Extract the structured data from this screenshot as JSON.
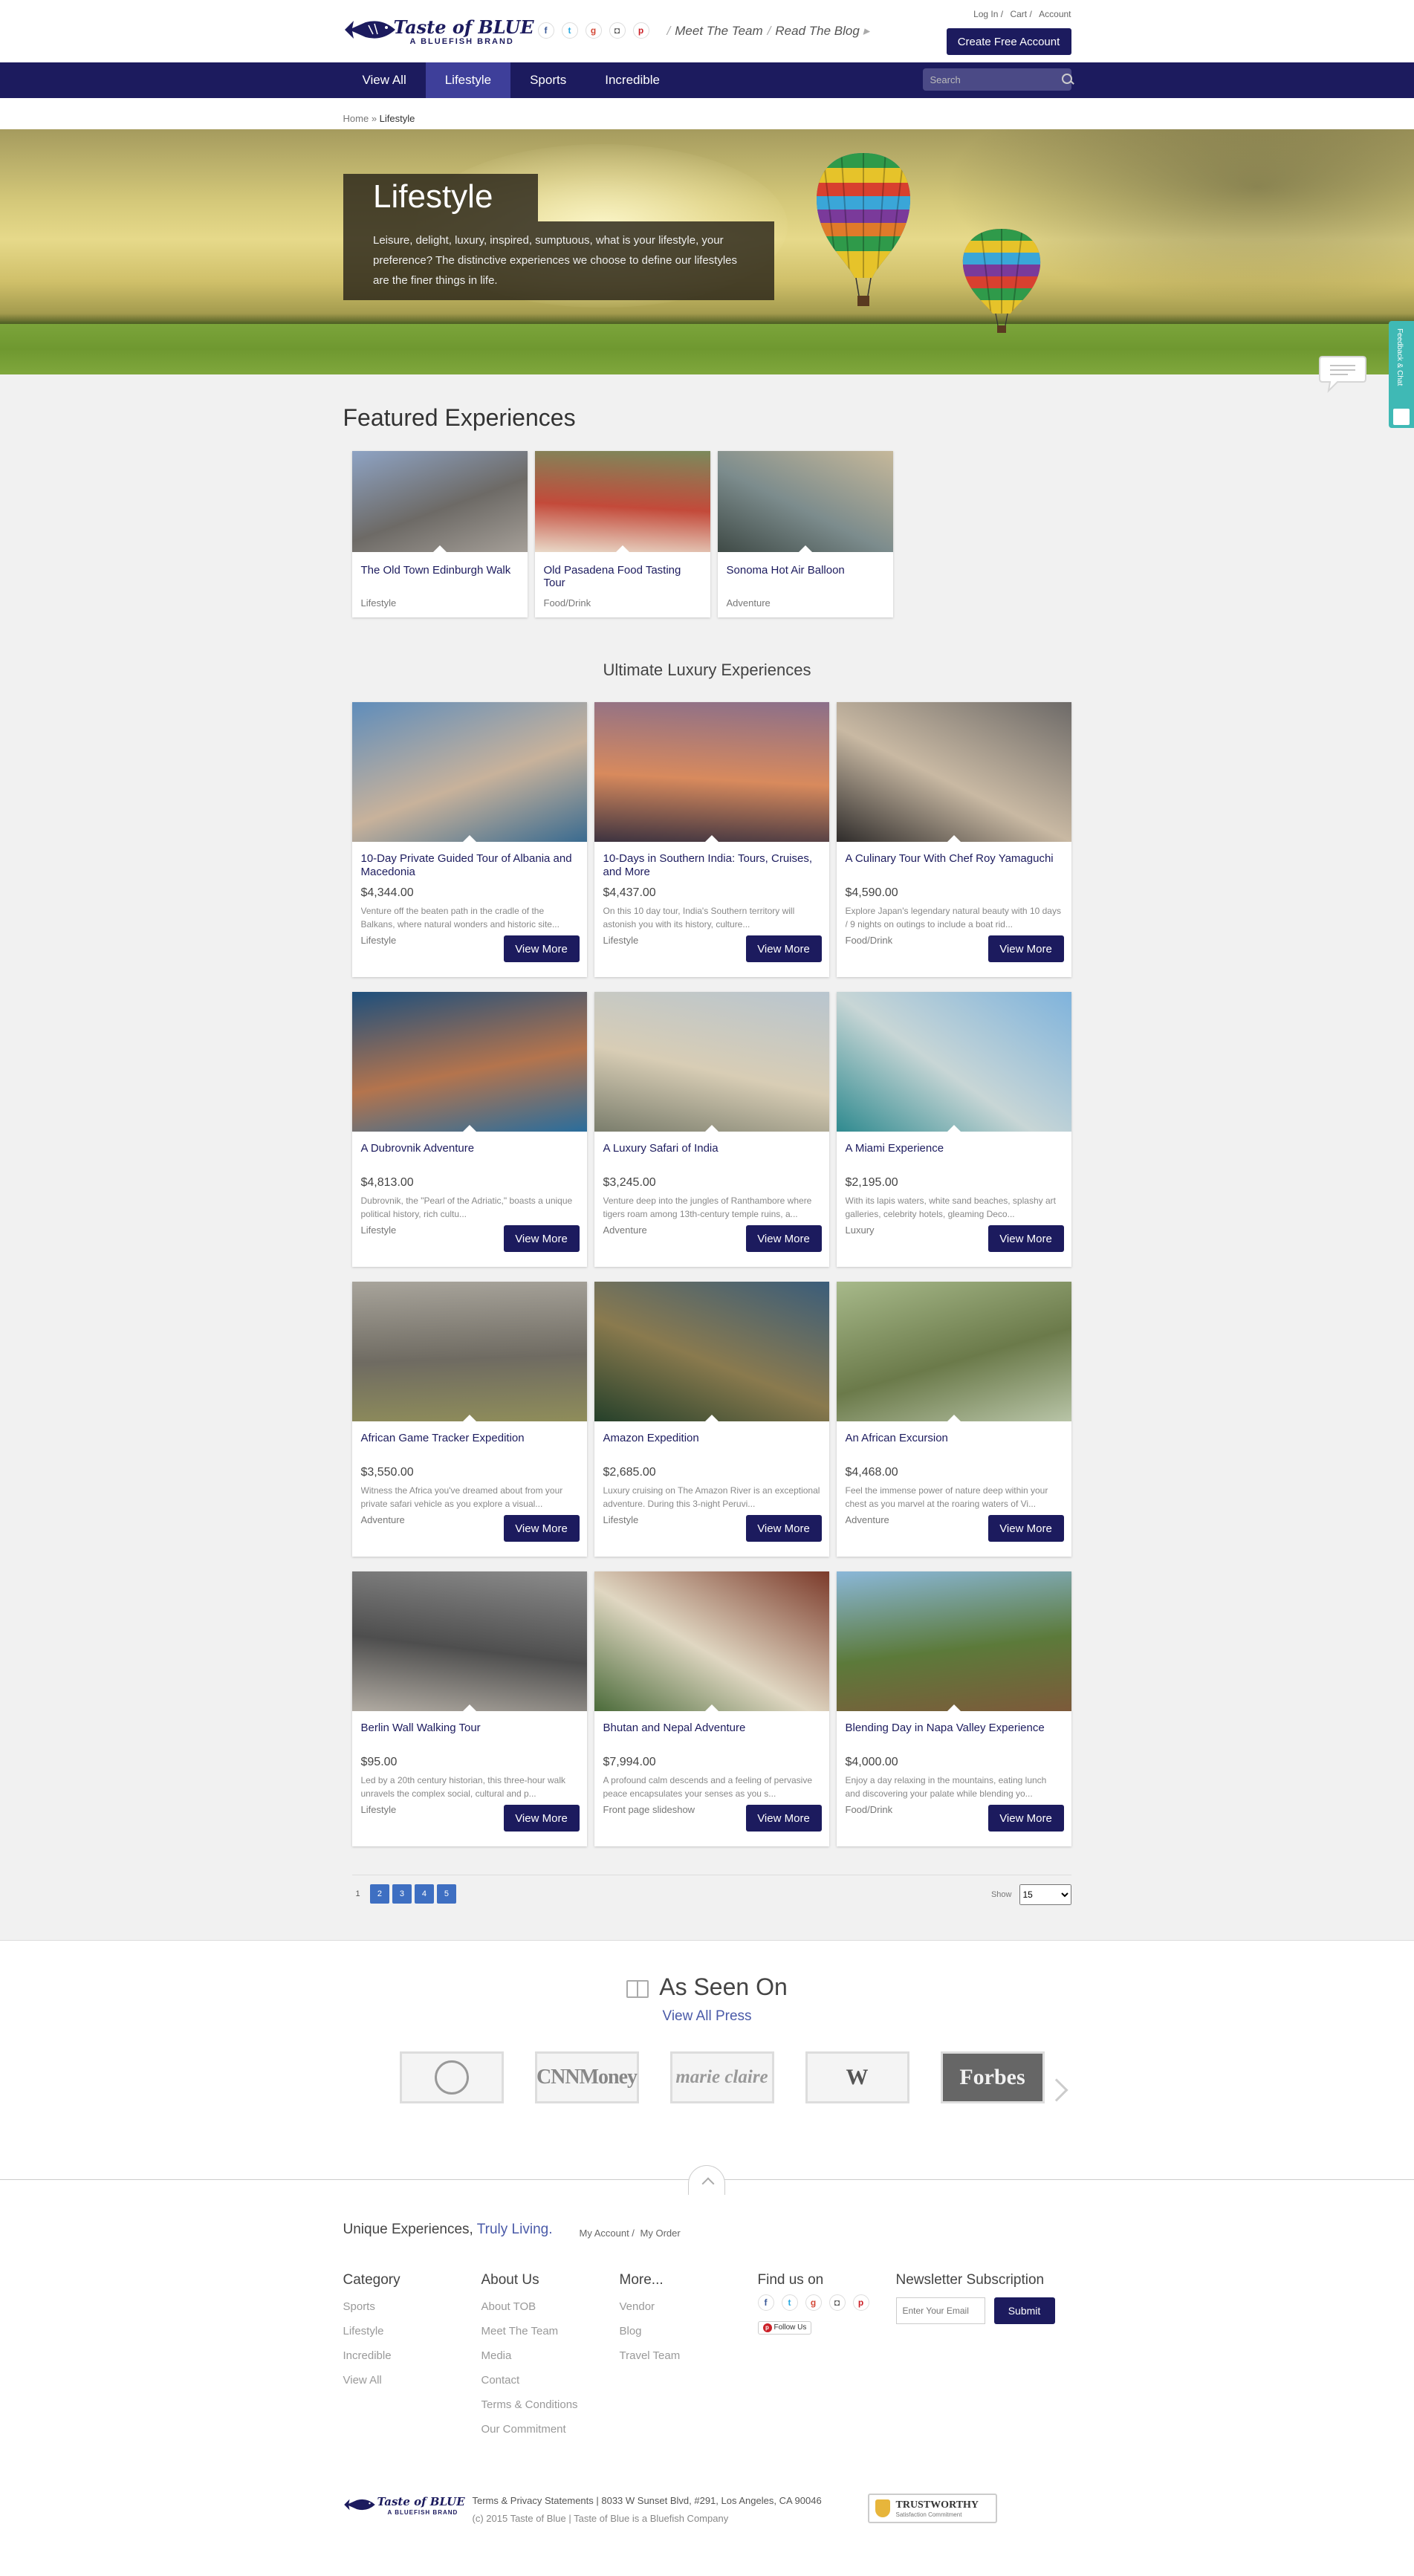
{
  "header": {
    "brand_name": "Taste of BLUE",
    "brand_tagline": "A BLUEFISH BRAND",
    "socials": [
      {
        "name": "facebook-icon",
        "glyph": "f"
      },
      {
        "name": "twitter-icon",
        "glyph": "t"
      },
      {
        "name": "google-plus-icon",
        "glyph": "g"
      },
      {
        "name": "instagram-icon",
        "glyph": "◘"
      },
      {
        "name": "pinterest-icon",
        "glyph": "p"
      }
    ],
    "meet_team": "Meet The Team",
    "read_blog": "Read The Blog",
    "login": "Log In /",
    "cart": "Cart /",
    "account": "Account",
    "create_account": "Create Free Account"
  },
  "nav": {
    "items": [
      "View All",
      "Lifestyle",
      "Sports",
      "Incredible"
    ],
    "active": "Lifestyle",
    "search_placeholder": "Search"
  },
  "breadcrumb": {
    "home": "Home",
    "sep": "»",
    "current": "Lifestyle"
  },
  "hero": {
    "title": "Lifestyle",
    "description": "Leisure, delight, luxury, inspired, sumptuous, what is your lifestyle, your preference? The distinctive experiences we choose to define our lifestyles are the finer things in life."
  },
  "featured": {
    "heading": "Featured Experiences",
    "items": [
      {
        "title": "The Old Town Edinburgh Walk",
        "category": "Lifestyle",
        "palette": [
          "#8ea3c4",
          "#6d6a66",
          "#a59f98"
        ]
      },
      {
        "title": "Old Pasadena Food Tasting Tour",
        "category": "Food/Drink",
        "palette": [
          "#7b8a5c",
          "#c34a3a",
          "#e9d9c8"
        ]
      },
      {
        "title": "Sonoma Hot Air Balloon",
        "category": "Adventure",
        "palette": [
          "#c6b89a",
          "#7c8c8d",
          "#3f4a46"
        ]
      }
    ]
  },
  "luxury": {
    "heading": "Ultimate Luxury Experiences",
    "view_more": "View More",
    "items": [
      {
        "title": "10-Day Private Guided Tour of Albania and Macedonia",
        "price": "$4,344.00",
        "desc": "Venture off the beaten path in the cradle of the Balkans, where natural wonders and historic site...",
        "category": "Lifestyle",
        "palette": [
          "#5f8dbb",
          "#c8b29b",
          "#3a6b90"
        ]
      },
      {
        "title": "10-Days in Southern India: Tours, Cruises, and More",
        "price": "$4,437.00",
        "desc": "On this 10 day tour, India's Southern territory will astonish you with its history, culture...",
        "category": "Lifestyle",
        "palette": [
          "#8b6f8a",
          "#d88a5d",
          "#3d3340"
        ]
      },
      {
        "title": "A Culinary Tour With Chef Roy Yamaguchi",
        "price": "$4,590.00",
        "desc": "Explore Japan's legendary natural beauty with 10 days / 9 nights on outings to include a boat rid...",
        "category": "Food/Drink",
        "palette": [
          "#6d6a68",
          "#c9b9a3",
          "#2f2c2b"
        ]
      },
      {
        "title": "A Dubrovnik Adventure",
        "price": "$4,813.00",
        "desc": "Dubrovnik, the \"Pearl of the Adriatic,\" boasts a unique political history, rich cultu...",
        "category": "Lifestyle",
        "palette": [
          "#1e4f7c",
          "#b4744d",
          "#2a6d9c"
        ]
      },
      {
        "title": "A Luxury Safari of India",
        "price": "$3,245.00",
        "desc": "Venture deep into the jungles of Ranthambore where tigers roam among 13th-century temple ruins, a...",
        "category": "Adventure",
        "palette": [
          "#b8c5cf",
          "#d8cdb5",
          "#7a7d6c"
        ]
      },
      {
        "title": "A Miami Experience",
        "price": "$2,195.00",
        "desc": "With its lapis waters, white sand beaches, splashy art galleries, celebrity hotels, gleaming Deco...",
        "category": "Luxury",
        "palette": [
          "#7fb3dc",
          "#c8d6d6",
          "#2f8a8f"
        ]
      },
      {
        "title": "African Game Tracker Expedition",
        "price": "$3,550.00",
        "desc": "Witness the Africa you've dreamed about from your private safari vehicle as you explore a visual...",
        "category": "Adventure",
        "palette": [
          "#a8a49b",
          "#6f6b62",
          "#8f8d5a"
        ]
      },
      {
        "title": "Amazon Expedition",
        "price": "$2,685.00",
        "desc": "Luxury cruising on The Amazon River is an exceptional adventure.  During this 3-night Peruvi...",
        "category": "Lifestyle",
        "palette": [
          "#3b5d7a",
          "#8a7a4e",
          "#25402a"
        ]
      },
      {
        "title": "An African Excursion",
        "price": "$4,468.00",
        "desc": "Feel the immense power of nature deep within your chest as you marvel at the roaring waters of Vi...",
        "category": "Adventure",
        "palette": [
          "#a7b98a",
          "#6b7a4a",
          "#b8c4a7"
        ]
      },
      {
        "title": "Berlin Wall Walking Tour",
        "price": "$95.00",
        "desc": "Led by a 20th century historian, this three-hour walk unravels the complex social, cultural and p...",
        "category": "Lifestyle",
        "palette": [
          "#8c8c8c",
          "#4e4e4e",
          "#b1aba2"
        ]
      },
      {
        "title": "Bhutan and Nepal Adventure",
        "price": "$7,994.00",
        "desc": "A profound calm descends and a feeling of pervasive peace encapsulates your senses as you s...",
        "category": "Front page slideshow",
        "palette": [
          "#7b3a2a",
          "#e0d7c2",
          "#4b6b3a"
        ]
      },
      {
        "title": "Blending Day in Napa Valley Experience",
        "price": "$4,000.00",
        "desc": "Enjoy a day relaxing in the mountains, eating lunch and discovering your palate while blending yo...",
        "category": "Food/Drink",
        "palette": [
          "#8ab7d8",
          "#5c7a3a",
          "#7d5a3a"
        ]
      }
    ]
  },
  "pagination": {
    "current": "1",
    "pages": [
      "2",
      "3",
      "4",
      "5"
    ],
    "show_label": "Show",
    "per_page": "15"
  },
  "press": {
    "heading": "As Seen On",
    "link": "View All Press",
    "logos": [
      {
        "name": "harvard-logo",
        "text": ""
      },
      {
        "name": "cnnmoney-logo",
        "text": "CNNMoney"
      },
      {
        "name": "marie-claire-logo",
        "text": "marie claire"
      },
      {
        "name": "w-magazine-logo",
        "text": "W"
      },
      {
        "name": "forbes-logo",
        "text": "Forbes"
      }
    ]
  },
  "footer": {
    "tagline": "Unique Experiences,",
    "tagline_accent": "Truly Living.",
    "my_account": "My Account /",
    "my_order": "My Order",
    "columns": [
      {
        "heading": "Category",
        "links": [
          "Sports",
          "Lifestyle",
          "Incredible",
          "View All"
        ]
      },
      {
        "heading": "About Us",
        "links": [
          "About TOB",
          "Meet The Team",
          "Media",
          "Contact",
          "Terms & Conditions",
          "Our Commitment"
        ]
      },
      {
        "heading": "More...",
        "links": [
          "Vendor",
          "Blog",
          "Travel Team"
        ]
      }
    ],
    "find_us": "Find us on",
    "follow_us": "Follow Us",
    "newsletter": "Newsletter Subscription",
    "email_placeholder": "Enter Your Email",
    "submit": "Submit",
    "address": "Terms & Privacy Statements | 8033 W Sunset Blvd, #291, Los Angeles, CA 90046",
    "copyright": "(c) 2015 Taste of Blue | Taste of Blue is a Bluefish Company",
    "trust_title": "TRUSTWORTHY",
    "trust_sub": "Satisfaction Commitment"
  },
  "feedback": {
    "label": "Feedback & Chat"
  }
}
